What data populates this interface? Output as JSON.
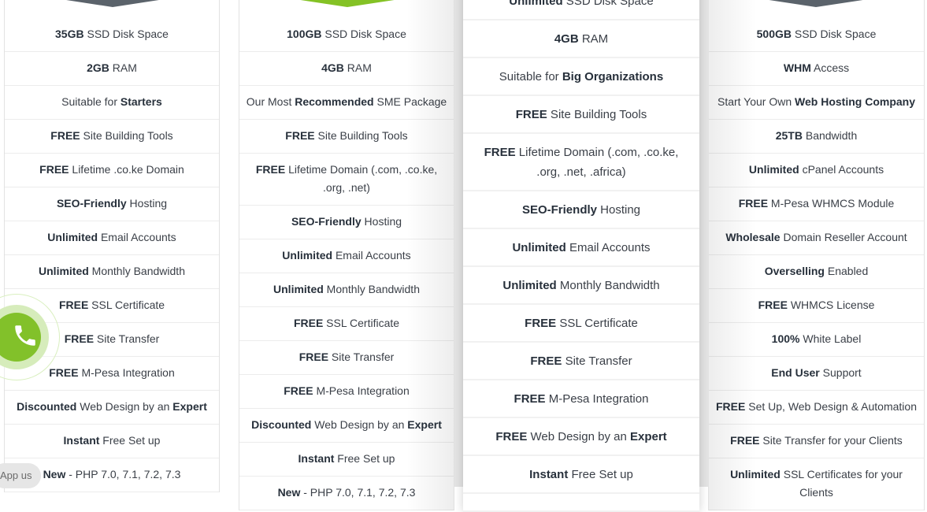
{
  "colors": {
    "accent_green": "#84c225",
    "ribbon_gray": "#5b636b",
    "text": "#3a3f47",
    "bold_text": "#27303b"
  },
  "plans": [
    {
      "id": "plan-1",
      "ribbon_color": "gray",
      "features": [
        [
          {
            "b": "35GB"
          },
          {
            "t": " SSD Disk Space"
          }
        ],
        [
          {
            "b": "2GB"
          },
          {
            "t": " RAM"
          }
        ],
        [
          {
            "t": "Suitable for "
          },
          {
            "b": "Starters"
          }
        ],
        [
          {
            "b": "FREE"
          },
          {
            "t": " Site Building Tools"
          }
        ],
        [
          {
            "b": "FREE"
          },
          {
            "t": " Lifetime .co.ke Domain"
          }
        ],
        [
          {
            "b": "SEO-Friendly"
          },
          {
            "t": " Hosting"
          }
        ],
        [
          {
            "b": "Unlimited"
          },
          {
            "t": " Email Accounts"
          }
        ],
        [
          {
            "b": "Unlimited"
          },
          {
            "t": " Monthly Bandwidth"
          }
        ],
        [
          {
            "b": "FREE"
          },
          {
            "t": " SSL Certificate"
          }
        ],
        [
          {
            "b": "FREE"
          },
          {
            "t": " Site Transfer"
          }
        ],
        [
          {
            "b": "FREE"
          },
          {
            "t": " M-Pesa Integration"
          }
        ],
        [
          {
            "b": "Discounted"
          },
          {
            "t": " Web Design by an "
          },
          {
            "b": "Expert"
          }
        ],
        [
          {
            "b": "Instant"
          },
          {
            "t": " Free Set up"
          }
        ],
        [
          {
            "b": "New"
          },
          {
            "t": " - PHP 7.0, 7.1, 7.2, 7.3"
          }
        ]
      ]
    },
    {
      "id": "plan-2",
      "ribbon_color": "green",
      "features": [
        [
          {
            "b": "100GB"
          },
          {
            "t": " SSD Disk Space"
          }
        ],
        [
          {
            "b": "4GB"
          },
          {
            "t": " RAM"
          }
        ],
        [
          {
            "t": "Our Most "
          },
          {
            "b": "Recommended"
          },
          {
            "t": " SME Package"
          }
        ],
        [
          {
            "b": "FREE"
          },
          {
            "t": " Site Building Tools"
          }
        ],
        [
          {
            "b": "FREE"
          },
          {
            "t": " Lifetime Domain (.com, .co.ke, .org, .net)"
          }
        ],
        [
          {
            "b": "SEO-Friendly"
          },
          {
            "t": " Hosting"
          }
        ],
        [
          {
            "b": "Unlimited"
          },
          {
            "t": " Email Accounts"
          }
        ],
        [
          {
            "b": "Unlimited"
          },
          {
            "t": " Monthly Bandwidth"
          }
        ],
        [
          {
            "b": "FREE"
          },
          {
            "t": " SSL Certificate"
          }
        ],
        [
          {
            "b": "FREE"
          },
          {
            "t": " Site Transfer"
          }
        ],
        [
          {
            "b": "FREE"
          },
          {
            "t": " M-Pesa Integration"
          }
        ],
        [
          {
            "b": "Discounted"
          },
          {
            "t": " Web Design by an "
          },
          {
            "b": "Expert"
          }
        ],
        [
          {
            "b": "Instant"
          },
          {
            "t": " Free Set up"
          }
        ],
        [
          {
            "b": "New"
          },
          {
            "t": " - PHP 7.0, 7.1, 7.2, 7.3"
          }
        ]
      ]
    },
    {
      "id": "plan-3",
      "featured": true,
      "features": [
        [
          {
            "b": "Unlimited"
          },
          {
            "t": " SSD Disk Space"
          }
        ],
        [
          {
            "b": "4GB"
          },
          {
            "t": " RAM"
          }
        ],
        [
          {
            "t": "Suitable for "
          },
          {
            "b": "Big Organizations"
          }
        ],
        [
          {
            "b": "FREE"
          },
          {
            "t": " Site Building Tools"
          }
        ],
        [
          {
            "b": "FREE"
          },
          {
            "t": " Lifetime Domain (.com, .co.ke, .org, .net, .africa)"
          }
        ],
        [
          {
            "b": "SEO-Friendly"
          },
          {
            "t": " Hosting"
          }
        ],
        [
          {
            "b": "Unlimited"
          },
          {
            "t": " Email Accounts"
          }
        ],
        [
          {
            "b": "Unlimited"
          },
          {
            "t": " Monthly Bandwidth"
          }
        ],
        [
          {
            "b": "FREE"
          },
          {
            "t": " SSL Certificate"
          }
        ],
        [
          {
            "b": "FREE"
          },
          {
            "t": " Site Transfer"
          }
        ],
        [
          {
            "b": "FREE"
          },
          {
            "t": " M-Pesa Integration"
          }
        ],
        [
          {
            "b": "FREE"
          },
          {
            "t": " Web Design by an "
          },
          {
            "b": "Expert"
          }
        ],
        [
          {
            "b": "Instant"
          },
          {
            "t": " Free Set up"
          }
        ],
        [
          {
            "t": " "
          }
        ]
      ]
    },
    {
      "id": "plan-4",
      "ribbon_color": "gray",
      "features": [
        [
          {
            "b": "500GB"
          },
          {
            "t": " SSD Disk Space"
          }
        ],
        [
          {
            "b": "WHM"
          },
          {
            "t": " Access"
          }
        ],
        [
          {
            "t": "Start Your Own "
          },
          {
            "b": "Web Hosting Company"
          }
        ],
        [
          {
            "b": "25TB"
          },
          {
            "t": " Bandwidth"
          }
        ],
        [
          {
            "b": "Unlimited"
          },
          {
            "t": " cPanel Accounts"
          }
        ],
        [
          {
            "b": "FREE"
          },
          {
            "t": " M-Pesa WHMCS Module"
          }
        ],
        [
          {
            "b": "Wholesale"
          },
          {
            "t": " Domain Reseller Account"
          }
        ],
        [
          {
            "b": "Overselling"
          },
          {
            "t": " Enabled"
          }
        ],
        [
          {
            "b": "FREE"
          },
          {
            "t": " WHMCS License"
          }
        ],
        [
          {
            "b": "100%"
          },
          {
            "t": " White Label"
          }
        ],
        [
          {
            "b": "End User"
          },
          {
            "t": " Support"
          }
        ],
        [
          {
            "b": "FREE"
          },
          {
            "t": " Set Up, Web Design & Automation"
          }
        ],
        [
          {
            "b": "FREE"
          },
          {
            "t": " Site Transfer for your Clients"
          }
        ],
        [
          {
            "b": "Unlimited"
          },
          {
            "t": " SSL Certificates for your Clients"
          }
        ]
      ]
    }
  ],
  "widgets": {
    "call_button_icon": "phone-icon",
    "app_chip_label": "App us"
  }
}
